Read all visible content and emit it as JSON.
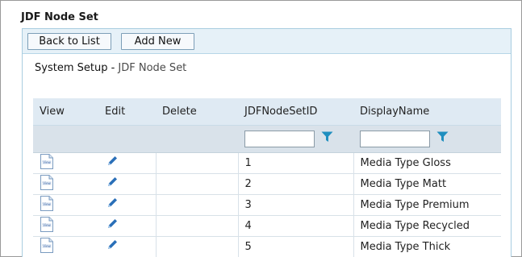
{
  "page": {
    "title": "JDF Node Set"
  },
  "toolbar": {
    "back_label": "Back to List",
    "add_label": "Add New"
  },
  "breadcrumb": {
    "root": "System Setup",
    "separator": " - ",
    "current": "JDF Node Set"
  },
  "table": {
    "columns": [
      "View",
      "Edit",
      "Delete",
      "JDFNodeSetID",
      "DisplayName"
    ],
    "filters": {
      "id_value": "",
      "name_value": ""
    },
    "rows": [
      {
        "id": "1",
        "name": "Media Type Gloss"
      },
      {
        "id": "2",
        "name": "Media Type Matt"
      },
      {
        "id": "3",
        "name": "Media Type Premium"
      },
      {
        "id": "4",
        "name": "Media Type Recycled"
      },
      {
        "id": "5",
        "name": "Media Type Thick"
      }
    ],
    "view_icon_text": "View"
  },
  "colors": {
    "accent": "#1f8fbf",
    "header_bg": "#dfeaf3",
    "toolbar_bg": "#e6f1f8"
  }
}
